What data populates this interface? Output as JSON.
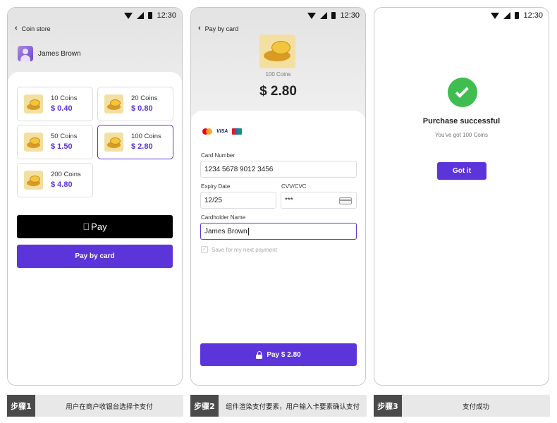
{
  "status_bar": {
    "time": "12:30"
  },
  "screen1": {
    "back_label": "Coin store",
    "user_name": "James Brown",
    "packages": [
      {
        "name": "10 Coins",
        "price": "$ 0.40",
        "selected": false
      },
      {
        "name": "20 Coins",
        "price": "$ 0.80",
        "selected": false
      },
      {
        "name": "50 Coins",
        "price": "$ 1.50",
        "selected": false
      },
      {
        "name": "100 Coins",
        "price": "$ 2.80",
        "selected": true
      },
      {
        "name": "200 Coins",
        "price": "$ 4.80",
        "selected": false
      }
    ],
    "apple_pay_label": "Pay",
    "pay_by_card_label": "Pay by card"
  },
  "screen2": {
    "back_label": "Pay by card",
    "coins_label": "100 Coins",
    "amount": "$ 2.80",
    "card_brands": [
      "mastercard-icon",
      "visa-icon",
      "unionpay-icon"
    ],
    "visa_text": "VISA",
    "card_number_label": "Card Number",
    "card_number_value": "1234 5678 9012 3456",
    "expiry_label": "Expiry Date",
    "expiry_value": "12/25",
    "cvv_label": "CVV/CVC",
    "cvv_value": "***",
    "holder_label": "Cardholder Name",
    "holder_value": "James Brown",
    "save_label": "Save for my next payment",
    "save_checked": true,
    "pay_button_label": "Pay $ 2.80"
  },
  "screen3": {
    "title": "Purchase successful",
    "subtitle": "You've got 100 Coins",
    "button_label": "Got it"
  },
  "steps": [
    {
      "badge": "步骤1",
      "desc": "用户在商户收银台选择卡支付"
    },
    {
      "badge": "步骤2",
      "desc": "组件渲染支付要素，用户输入卡要素确认支付"
    },
    {
      "badge": "步骤3",
      "desc": "支付成功"
    }
  ],
  "colors": {
    "accent": "#5b35d9",
    "success": "#3fbd4f",
    "apple_pay": "#000000"
  }
}
